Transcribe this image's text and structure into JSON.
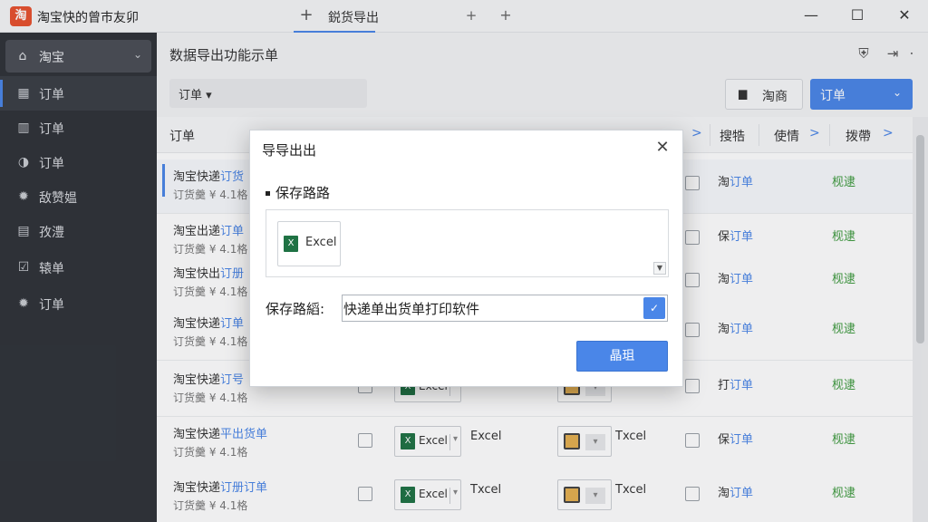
{
  "app": {
    "logo_text": "淘",
    "title": "淘宝快的曾巿友卯",
    "tab_plus": "+",
    "active_tab": "鋭货导出",
    "tab_close": "+",
    "tab_add": "+"
  },
  "window_controls": {
    "minimize": "—",
    "maximize": "☐",
    "close": "✕"
  },
  "sidebar": {
    "top": {
      "label": "淘宝",
      "icon": "shop-icon"
    },
    "items": [
      {
        "label": "订单",
        "icon": "calendar-icon"
      },
      {
        "label": "订单",
        "icon": "grid-icon"
      },
      {
        "label": "订单",
        "icon": "circle-icon"
      },
      {
        "label": "敌赞媪",
        "icon": "gear-icon"
      },
      {
        "label": "孜澧",
        "icon": "calendar-icon"
      },
      {
        "label": "辕单",
        "icon": "checkbox-icon"
      },
      {
        "label": "订单",
        "icon": "gear-icon"
      }
    ]
  },
  "main": {
    "page_title": "数据导出功能示单",
    "filter": "订单 ▾",
    "export_button": "淘商",
    "primary_button": "订单",
    "columns": {
      "col1": "订单",
      "col_extra1": "搜牿",
      "col_extra2": "使情",
      "col_extra3": "拨帶",
      "arrow": ">"
    },
    "rows": [
      {
        "title_a": "淘宝快递",
        "title_b": "订货",
        "sub": "订货羹 ¥ 4.1格",
        "fmt": "",
        "tpl": "",
        "act1_a": "淘",
        "act1_b": "订单",
        "act2": "枧逮"
      },
      {
        "title_a": "淘宝出递",
        "title_b": "订单",
        "sub": "订货羹 ¥ 4.1格",
        "fmt": "",
        "tpl": "",
        "act1_a": "保",
        "act1_b": "订单",
        "act2": "枧逮"
      },
      {
        "title_a": "淘宝快出",
        "title_b": "订册",
        "sub": "订货羹 ¥ 4.1格",
        "fmt": "",
        "tpl": "",
        "act1_a": "淘",
        "act1_b": "订单",
        "act2": "枧逮"
      },
      {
        "title_a": "淘宝快递",
        "title_b": "订单",
        "sub": "订货羹 ¥ 4.1格",
        "fmt": "",
        "tpl": "",
        "act1_a": "淘",
        "act1_b": "订单",
        "act2": "枧逮"
      },
      {
        "title_a": "淘宝快递",
        "title_b": "订号",
        "sub": "订货羹 ¥ 4.1格",
        "fmt": "",
        "tpl": "",
        "act1_a": "打",
        "act1_b": "订单",
        "act2": "枧逮"
      },
      {
        "title_a": "淘宝快递",
        "title_b": "平出货单",
        "sub": "订货羹 ¥ 4.1格",
        "fmt": "Excel",
        "tpl": "Txcel",
        "act1_a": "保",
        "act1_b": "订单",
        "act2": "枧逮"
      },
      {
        "title_a": "淘宝快递",
        "title_b": "订册订单",
        "sub": "订货羹 ¥ 4.1格",
        "fmt": "Txcel",
        "tpl": "Txcel",
        "act1_a": "淘",
        "act1_b": "订单",
        "act2": "枧逮"
      }
    ],
    "excel_label": "Excel"
  },
  "dialog": {
    "title": "导导出出",
    "close": "✕",
    "section": "保存路路",
    "file_name": "Excel",
    "path_label": "保存路縚:",
    "path_value": "快递单出货单打印软件",
    "confirm": "晶珇"
  }
}
